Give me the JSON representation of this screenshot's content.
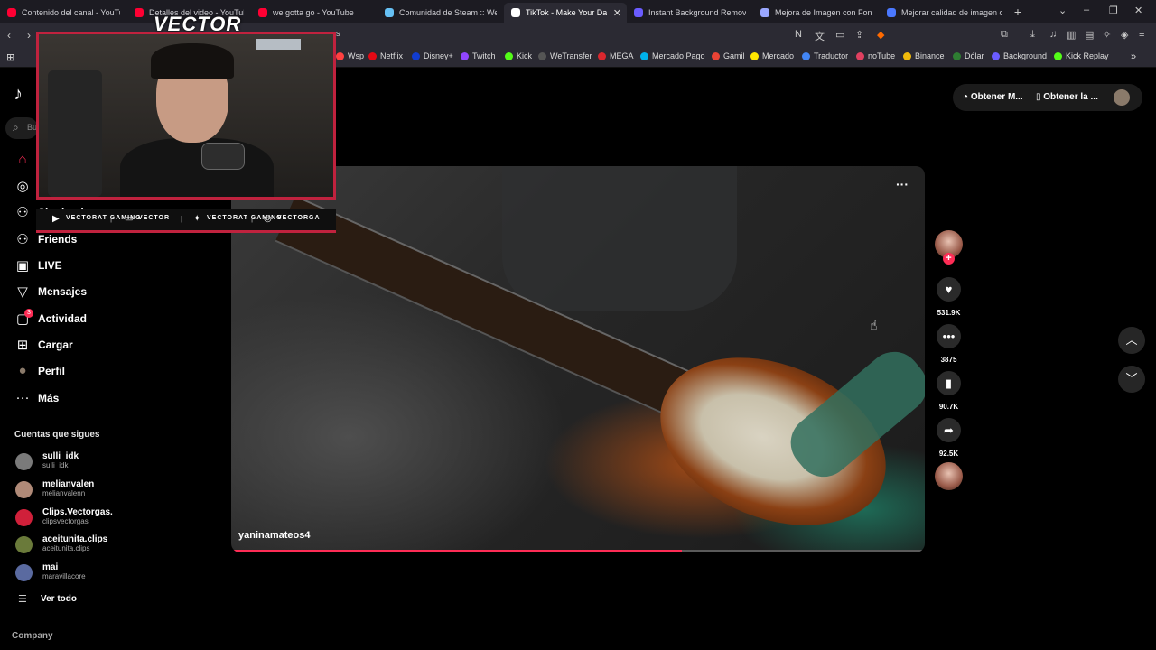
{
  "browser": {
    "tabs": [
      {
        "label": "Contenido del canal - YouTube",
        "color": "#ff0033",
        "active": false
      },
      {
        "label": "Detalles del video - YouTube S",
        "color": "#ff0033",
        "active": false
      },
      {
        "label": "we gotta go - YouTube",
        "color": "#ff0033",
        "active": false
      },
      {
        "label": "Comunidad de Steam :: We G",
        "color": "#66c0f4",
        "active": false
      },
      {
        "label": "TikTok - Make Your Da",
        "color": "#ffffff",
        "active": true
      },
      {
        "label": "Instant Background Remover",
        "color": "#6b5cff",
        "active": false
      },
      {
        "label": "Mejora de Imagen con Fondo",
        "color": "#9aa7ff",
        "active": false
      },
      {
        "label": "Mejorar calidad de imagen on",
        "color": "#4a78ff",
        "active": false
      }
    ],
    "new_tab": "+",
    "url_fragment": "s",
    "bookmarks": [
      {
        "label": "Wsp",
        "color": "#ff4040"
      },
      {
        "label": "Netflix",
        "color": "#e50914"
      },
      {
        "label": "Disney+",
        "color": "#113ccf"
      },
      {
        "label": "Twitch",
        "color": "#9146ff"
      },
      {
        "label": "Kick",
        "color": "#53fc18"
      },
      {
        "label": "WeTransfer",
        "color": "#555555"
      },
      {
        "label": "MEGA",
        "color": "#d9272e"
      },
      {
        "label": "Mercado Pago",
        "color": "#00b1ea"
      },
      {
        "label": "Gamil",
        "color": "#ea4335"
      },
      {
        "label": "Mercado",
        "color": "#ffe600"
      },
      {
        "label": "Traductor",
        "color": "#4285f4"
      },
      {
        "label": "noTube",
        "color": "#e04060"
      },
      {
        "label": "Binance",
        "color": "#f0b90b"
      },
      {
        "label": "Dólar",
        "color": "#2e7d32"
      },
      {
        "label": "Background",
        "color": "#6b5cff"
      },
      {
        "label": "Kick Replay",
        "color": "#53fc18"
      }
    ]
  },
  "tiktok": {
    "logo": "♪",
    "search_placeholder": "Bu",
    "nav": [
      {
        "icon": "⌂",
        "label": "",
        "icon_name": "home-icon",
        "color": "#fe2c55"
      },
      {
        "icon": "◎",
        "label": "",
        "icon_name": "explore-icon",
        "color": "#ffffff"
      },
      {
        "icon": "⚇",
        "label": "Siguiendo",
        "icon_name": "following-icon",
        "color": "#ffffff"
      },
      {
        "icon": "⚇",
        "label": "Friends",
        "icon_name": "friends-icon",
        "color": "#ffffff"
      },
      {
        "icon": "▣",
        "label": "LIVE",
        "icon_name": "live-icon",
        "color": "#ffffff"
      },
      {
        "icon": "▽",
        "label": "Mensajes",
        "icon_name": "messages-icon",
        "color": "#ffffff"
      },
      {
        "icon": "▢",
        "label": "Actividad",
        "icon_name": "activity-icon",
        "color": "#ffffff"
      },
      {
        "icon": "⊞",
        "label": "Cargar",
        "icon_name": "upload-icon",
        "color": "#ffffff"
      },
      {
        "icon": "●",
        "label": "Perfil",
        "icon_name": "profile-avatar",
        "color": "#8a7a6a"
      },
      {
        "icon": "···",
        "label": "Más",
        "icon_name": "more-icon",
        "color": "#ffffff"
      }
    ],
    "activity_badge": "3",
    "following_title": "Cuentas que sigues",
    "accounts": [
      {
        "name": "sulli_idk",
        "handle": "sulli_idk_",
        "color": "#7a7a7a"
      },
      {
        "name": "melianvalen",
        "handle": "melianvalenn",
        "color": "#b08a78"
      },
      {
        "name": "Clips.Vectorgas.",
        "handle": "clipsvectorgas",
        "color": "#d0203a"
      },
      {
        "name": "aceitunita.clips",
        "handle": "aceitunita.clips",
        "color": "#6a7a3a"
      },
      {
        "name": "mai",
        "handle": "maravillacore",
        "color": "#5a6aa0"
      }
    ],
    "see_all": "Ver todo",
    "company": "Company",
    "top_right": {
      "item1": "Obtener M...",
      "item2": "Obtener la ..."
    },
    "video": {
      "author": "yaninamateos4",
      "progress_pct": 65,
      "menu": "···"
    },
    "rail": {
      "like_count": "531.9K",
      "comment_count": "3875",
      "save_count": "90.7K",
      "share_count": "92.5K"
    }
  },
  "overlay": {
    "title": "VECTOR",
    "socials": [
      {
        "icon": "▶",
        "text": "VECTORAT GAMING"
      },
      {
        "icon": "▭",
        "text": "VECTOR"
      },
      {
        "icon": "✦",
        "text": "VECTORAT GAMING"
      },
      {
        "icon": "◎",
        "text": "VECTORGA"
      }
    ]
  }
}
